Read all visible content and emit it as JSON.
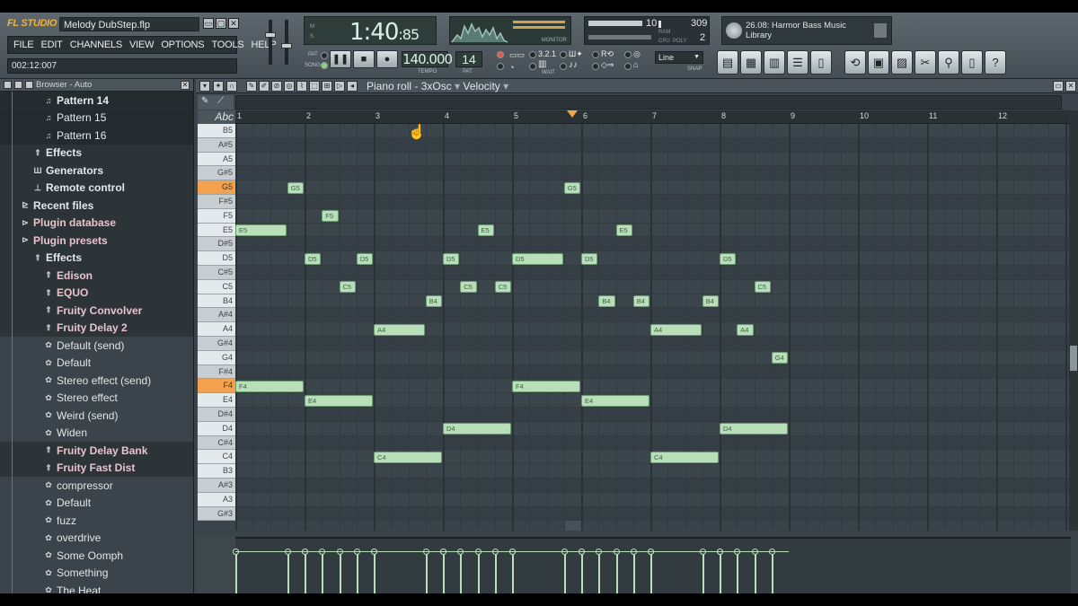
{
  "app": {
    "logo": "FL STUDIO",
    "file_name": "Melody DubStep.flp",
    "menu": [
      "FILE",
      "EDIT",
      "CHANNELS",
      "VIEW",
      "OPTIONS",
      "TOOLS",
      "HELP"
    ],
    "song_position_hint": "002:12:007"
  },
  "display": {
    "time_main": "1:40",
    "time_frac": ":85",
    "label_m": "M",
    "label_s": "S",
    "monitor": "MONITOR",
    "cpu_label": "CPU",
    "poly_label": "POLY",
    "ram_label": "RAM",
    "cpu_value": "10",
    "ram_value": "309",
    "poly_value": "2"
  },
  "hint": {
    "text": "26.08: Harmor Bass Music Library"
  },
  "transport": {
    "pat_label": "PAT",
    "song_label": "SONG",
    "tempo_value": "140.000",
    "tempo_label": "TEMPO",
    "pattern_value": "14",
    "pattern_label": "PAT",
    "snap_value": "Line",
    "snap_label": "SNAP",
    "wait_label": "WAIT"
  },
  "browser": {
    "header": "Browser - Auto",
    "items": [
      {
        "label": "Pattern 14",
        "style": "sel",
        "icon": "♫",
        "indent": 48
      },
      {
        "label": "Pattern 15",
        "style": "dark",
        "icon": "♫",
        "indent": 48
      },
      {
        "label": "Pattern 16",
        "style": "dark",
        "icon": "♫",
        "indent": 48
      },
      {
        "label": "Effects",
        "style": "cat",
        "icon": "⇑",
        "indent": 36
      },
      {
        "label": "Generators",
        "style": "cat",
        "icon": "Ш",
        "indent": 36
      },
      {
        "label": "Remote control",
        "style": "cat",
        "icon": "⊥",
        "indent": 36
      },
      {
        "label": "Recent files",
        "style": "cat",
        "icon": "⊵",
        "indent": 22
      },
      {
        "label": "Plugin database",
        "style": "plugin",
        "icon": "⊳",
        "indent": 22
      },
      {
        "label": "Plugin presets",
        "style": "plugin",
        "icon": "⊳",
        "indent": 22
      },
      {
        "label": "Effects",
        "style": "cat",
        "icon": "⇑",
        "indent": 36
      },
      {
        "label": "Edison",
        "style": "plugin",
        "icon": "⇑",
        "indent": 48
      },
      {
        "label": "EQUO",
        "style": "plugin",
        "icon": "⇑",
        "indent": 48
      },
      {
        "label": "Fruity Convolver",
        "style": "plugin",
        "icon": "⇑",
        "indent": 48
      },
      {
        "label": "Fruity Delay 2",
        "style": "plugin",
        "icon": "⇑",
        "indent": 48
      },
      {
        "label": "Default (send)",
        "style": "preset",
        "icon": "✿",
        "indent": 48
      },
      {
        "label": "Default",
        "style": "preset",
        "icon": "✿",
        "indent": 48
      },
      {
        "label": "Stereo effect (send)",
        "style": "preset",
        "icon": "✿",
        "indent": 48
      },
      {
        "label": "Stereo effect",
        "style": "preset",
        "icon": "✿",
        "indent": 48
      },
      {
        "label": "Weird (send)",
        "style": "preset",
        "icon": "✿",
        "indent": 48
      },
      {
        "label": "Widen",
        "style": "preset",
        "icon": "✿",
        "indent": 48
      },
      {
        "label": "Fruity Delay Bank",
        "style": "plugin",
        "icon": "⇑",
        "indent": 48
      },
      {
        "label": "Fruity Fast Dist",
        "style": "plugin",
        "icon": "⇑",
        "indent": 48
      },
      {
        "label": "compressor",
        "style": "preset",
        "icon": "✿",
        "indent": 48
      },
      {
        "label": "Default",
        "style": "preset",
        "icon": "✿",
        "indent": 48
      },
      {
        "label": "fuzz",
        "style": "preset",
        "icon": "✿",
        "indent": 48
      },
      {
        "label": "overdrive",
        "style": "preset",
        "icon": "✿",
        "indent": 48
      },
      {
        "label": "Some Oomph",
        "style": "preset",
        "icon": "✿",
        "indent": 48
      },
      {
        "label": "Something",
        "style": "preset",
        "icon": "✿",
        "indent": 48
      },
      {
        "label": "The Heat",
        "style": "preset",
        "icon": "✿",
        "indent": 48
      }
    ]
  },
  "piano_roll": {
    "title_prefix": "Piano roll - ",
    "instrument": "3xOsc",
    "target": "Velocity",
    "keyboard_header": "Abc",
    "keys": [
      "B5",
      "A#5",
      "A5",
      "G#5",
      "G5",
      "F#5",
      "F5",
      "E5",
      "D#5",
      "D5",
      "C#5",
      "C5",
      "B4",
      "A#4",
      "A4",
      "G#4",
      "G4",
      "F#4",
      "F4",
      "E4",
      "D#4",
      "D4",
      "C#4",
      "C4",
      "B3",
      "A#3",
      "A3",
      "G#3"
    ],
    "highlighted_keys": [
      "G5",
      "F4"
    ],
    "bar_numbers": [
      "1",
      "2",
      "3",
      "4",
      "5",
      "6",
      "7",
      "8",
      "9",
      "10",
      "11",
      "12"
    ],
    "notes_unit": "beats from start (4 beats per bar)",
    "notes": [
      {
        "pitch": "E5",
        "start": 0,
        "length": 3
      },
      {
        "pitch": "G5",
        "start": 3,
        "length": 1
      },
      {
        "pitch": "F5",
        "start": 5,
        "length": 1
      },
      {
        "pitch": "D5",
        "start": 4,
        "length": 1
      },
      {
        "pitch": "C5",
        "start": 6,
        "length": 1
      },
      {
        "pitch": "D5",
        "start": 7,
        "length": 1
      },
      {
        "pitch": "F4",
        "start": 0,
        "length": 4
      },
      {
        "pitch": "E4",
        "start": 4,
        "length": 4
      },
      {
        "pitch": "A4",
        "start": 8,
        "length": 3
      },
      {
        "pitch": "C4",
        "start": 8,
        "length": 4
      },
      {
        "pitch": "B4",
        "start": 11,
        "length": 1
      },
      {
        "pitch": "D5",
        "start": 12,
        "length": 1
      },
      {
        "pitch": "D4",
        "start": 12,
        "length": 4
      },
      {
        "pitch": "C5",
        "start": 13,
        "length": 1
      },
      {
        "pitch": "E5",
        "start": 14,
        "length": 1
      },
      {
        "pitch": "C5",
        "start": 15,
        "length": 1
      },
      {
        "pitch": "D5",
        "start": 16,
        "length": 3
      },
      {
        "pitch": "F4",
        "start": 16,
        "length": 4
      },
      {
        "pitch": "G5",
        "start": 19,
        "length": 1
      },
      {
        "pitch": "D5",
        "start": 20,
        "length": 1
      },
      {
        "pitch": "E4",
        "start": 20,
        "length": 4
      },
      {
        "pitch": "B4",
        "start": 21,
        "length": 1
      },
      {
        "pitch": "E5",
        "start": 22,
        "length": 1
      },
      {
        "pitch": "B4",
        "start": 23,
        "length": 1
      },
      {
        "pitch": "A4",
        "start": 24,
        "length": 3
      },
      {
        "pitch": "C4",
        "start": 24,
        "length": 4
      },
      {
        "pitch": "B4",
        "start": 27,
        "length": 1
      },
      {
        "pitch": "D5",
        "start": 28,
        "length": 1
      },
      {
        "pitch": "D4",
        "start": 28,
        "length": 4
      },
      {
        "pitch": "A4",
        "start": 29,
        "length": 1
      },
      {
        "pitch": "C5",
        "start": 30,
        "length": 1
      },
      {
        "pitch": "G4",
        "start": 31,
        "length": 1
      }
    ],
    "playhead_beat": 19.5
  },
  "tools": [
    "playlist",
    "step-seq",
    "piano",
    "channels",
    "mixer",
    "undo",
    "save",
    "disk",
    "cut",
    "search",
    "file",
    "help"
  ]
}
